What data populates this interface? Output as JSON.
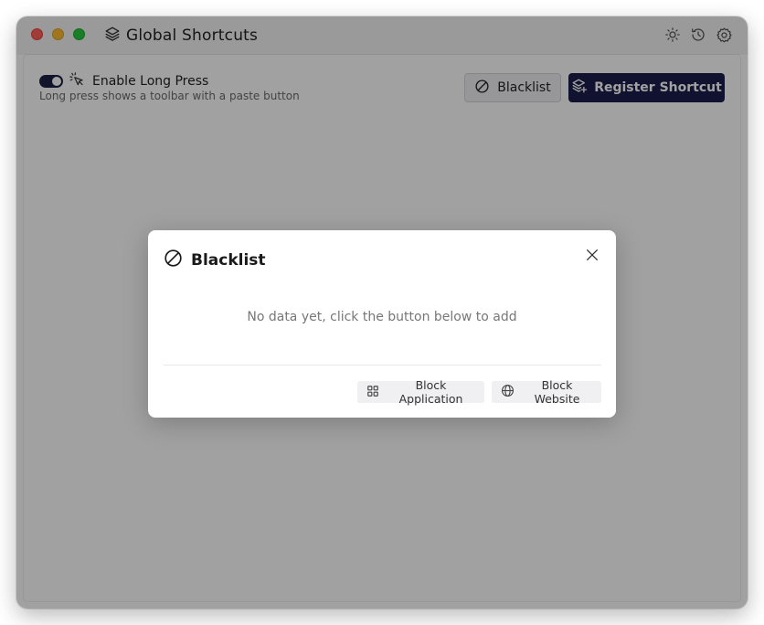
{
  "window": {
    "title": "Global Shortcuts"
  },
  "titlebar": {
    "icons": [
      "sun-icon",
      "history-icon",
      "gear-icon"
    ]
  },
  "long_press": {
    "enabled": true,
    "label": "Enable Long Press",
    "description": "Long press shows a toolbar with a paste button"
  },
  "toolbar": {
    "blacklist_label": "Blacklist",
    "register_label": "Register Shortcut"
  },
  "modal": {
    "title": "Blacklist",
    "empty_text": "No data yet, click the button below to add",
    "block_application_label": "Block Application",
    "block_website_label": "Block Website"
  },
  "colors": {
    "accent": "#1b1e4b",
    "traffic_close": "#ff5f57",
    "traffic_minimize": "#febc2e",
    "traffic_maximize": "#28c840"
  }
}
